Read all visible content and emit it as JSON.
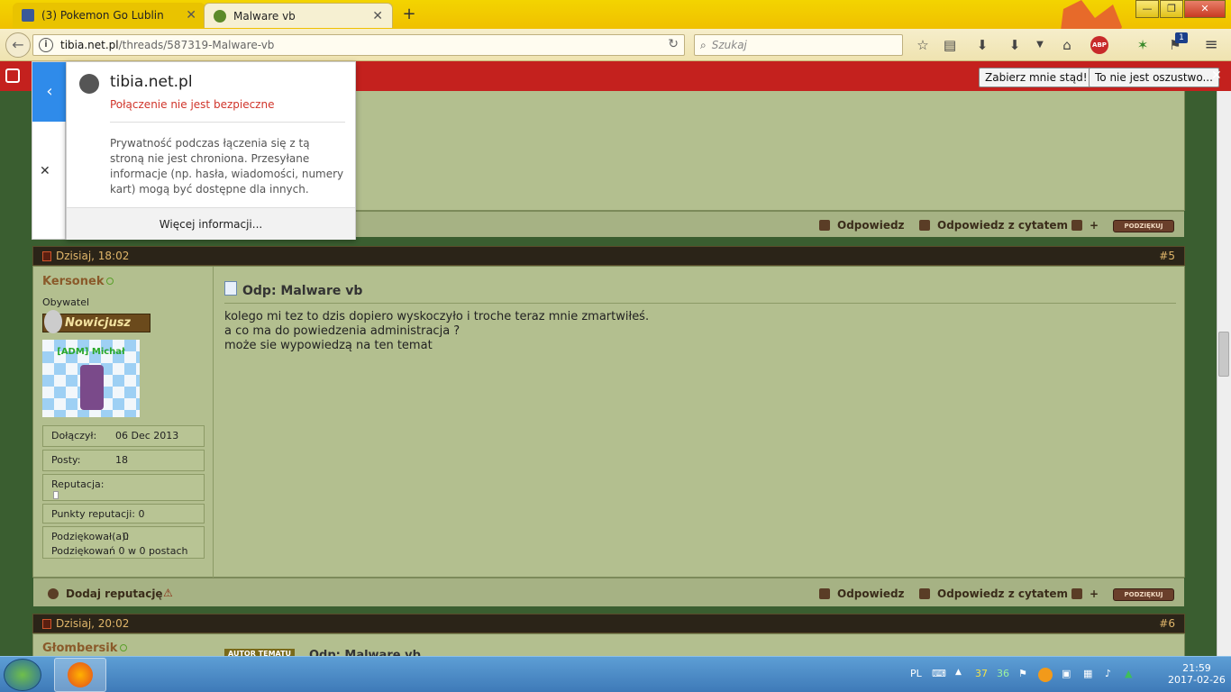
{
  "browser": {
    "tabs": [
      {
        "label": "(3) Pokemon Go Lublin",
        "favicon_color": "#3b5998"
      },
      {
        "label": "Malware vb",
        "favicon_color": "#5c8a2a"
      }
    ],
    "new_tab": "+",
    "window_buttons": {
      "minimize": "—",
      "maximize": "❐",
      "close": "✕"
    },
    "url_host": "tibia.net.pl",
    "url_path": "/threads/587319-Malware-vb",
    "search_placeholder": "Szukaj",
    "abp_label": "ABP",
    "notification_count": "1"
  },
  "notification": {
    "btn_leave": "Zabierz mnie stąd!",
    "btn_not_fraud": "To nie jest oszustwo...",
    "close": "✕"
  },
  "popup": {
    "host": "tibia.net.pl",
    "warning": "Połączenie nie jest bezpieczne",
    "description": "Prywatność podczas łączenia się z tą stroną nie jest chroniona. Przesyłane informacje (np. hasła, wiadomości, numery kart) mogą być dostępne dla innych.",
    "more_info": "Więcej informacji...",
    "back": "‹",
    "close": "✕"
  },
  "post_footer": {
    "reply": "Odpowiedz",
    "reply_quote": "Odpowiedz z cytatem",
    "thanks": "PODZIĘKUJ",
    "add_rep": "Dodaj reputację"
  },
  "post5": {
    "date": "Dzisiaj, 18:02",
    "number": "#5",
    "username": "Kersonek",
    "rank": "Obywatel",
    "rank_badge": "Nowicjusz",
    "avatar_caption": "[ADM] Michał",
    "joined_label": "Dołączył:",
    "joined_value": "06 Dec 2013",
    "posts_label": "Posty:",
    "posts_value": "18",
    "reputation_label": "Reputacja:",
    "rep_points": "Punkty reputacji: 0",
    "thanked_label": "Podziękował(a):",
    "thanked_value": "0",
    "thanked_in": "Podziękowań 0 w 0 postach",
    "title": "Odp: Malware vb",
    "lines": [
      "kolego mi tez to dzis dopiero wyskoczyło i troche teraz mnie zmartwiłeś.",
      "a co ma do powiedzenia administracja ?",
      "może sie wypowiedzą na ten temat"
    ]
  },
  "post6": {
    "date": "Dzisiaj, 20:02",
    "number": "#6",
    "username": "Głombersik",
    "author_badge": "AUTOR TEMATU",
    "title": "Odp: Malware vb"
  },
  "taskbar": {
    "lang": "PL",
    "tray_37": "37",
    "tray_36": "36",
    "time": "21:59",
    "date": "2017-02-26"
  }
}
